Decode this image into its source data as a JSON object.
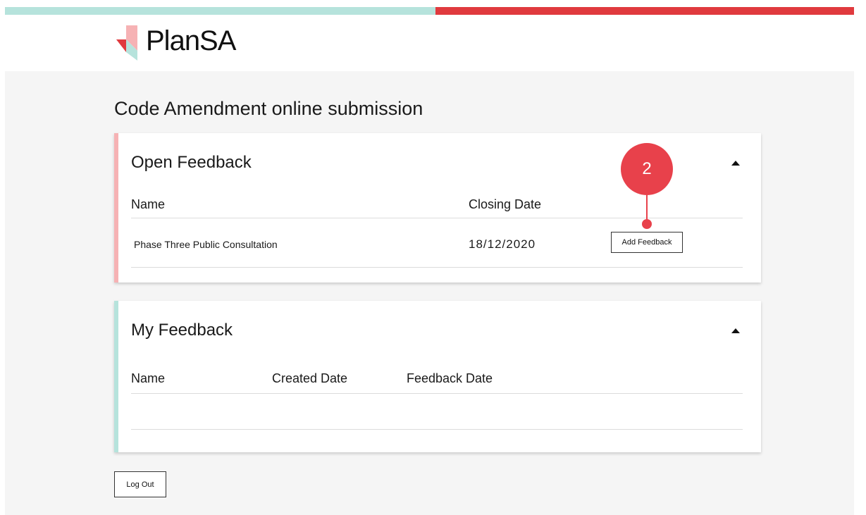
{
  "header": {
    "logo_text": "PlanSA",
    "colors": {
      "teal": "#b6e3dc",
      "red": "#e03a3e"
    }
  },
  "page": {
    "title": "Code Amendment online submission"
  },
  "open_feedback": {
    "title": "Open Feedback",
    "columns": {
      "name": "Name",
      "closing_date": "Closing Date"
    },
    "rows": [
      {
        "name": "Phase Three Public Consultation",
        "closing_date": "18/12/2020",
        "action_label": "Add Feedback"
      }
    ]
  },
  "my_feedback": {
    "title": "My Feedback",
    "columns": {
      "name": "Name",
      "created_date": "Created Date",
      "feedback_date": "Feedback Date"
    },
    "rows": []
  },
  "logout_label": "Log Out",
  "annotation": {
    "step_number": "2",
    "color": "#e8414b"
  }
}
